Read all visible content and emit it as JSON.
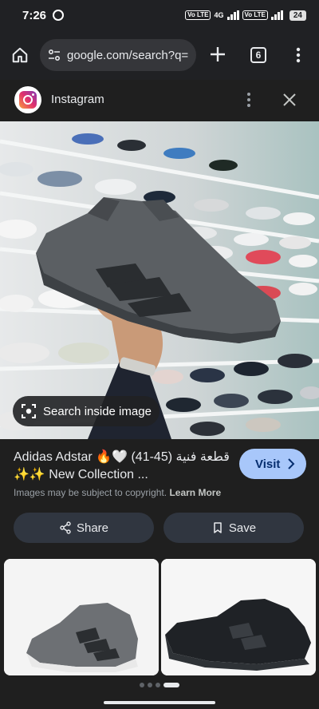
{
  "status_bar": {
    "time": "7:26",
    "network": "4G",
    "volte_1": "Vo LTE",
    "volte_2": "Vo LTE",
    "battery": "24"
  },
  "browser": {
    "url": "google.com/search?q=",
    "tab_count": "6"
  },
  "source": {
    "name": "Instagram"
  },
  "image_viewer": {
    "search_inside_label": "Search inside image"
  },
  "result": {
    "title": "Adidas Adstar 🔥🤍 قطعة فنية (45-41) ✨✨ New Collection ...",
    "copyright_text": "Images may be subject to copyright.",
    "learn_more": "Learn More",
    "visit_label": "Visit"
  },
  "actions": {
    "share_label": "Share",
    "save_label": "Save"
  },
  "colors": {
    "background": "#1f1f1f",
    "visit_button": "#a8c7fa",
    "pill_button": "#303640"
  }
}
